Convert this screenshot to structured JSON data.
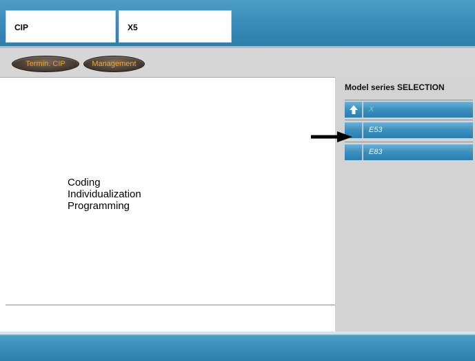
{
  "header": {
    "cip_label": "CIP",
    "model_label": "X5"
  },
  "toolbar": {
    "termin_label": "Termin. CIP",
    "management_label": "Management"
  },
  "main": {
    "lines": [
      "Coding",
      "Individualization",
      "Programming"
    ]
  },
  "sidebar": {
    "title": "Model series SELECTION",
    "rows": [
      {
        "label": "X",
        "icon": "arrow-up-icon"
      },
      {
        "label": "E53"
      },
      {
        "label": "E83"
      }
    ]
  },
  "colors": {
    "banner_blue": "#3b8dbb",
    "button_text_orange": "#f2a42a",
    "sidebar_gray": "#d3d3d3"
  }
}
